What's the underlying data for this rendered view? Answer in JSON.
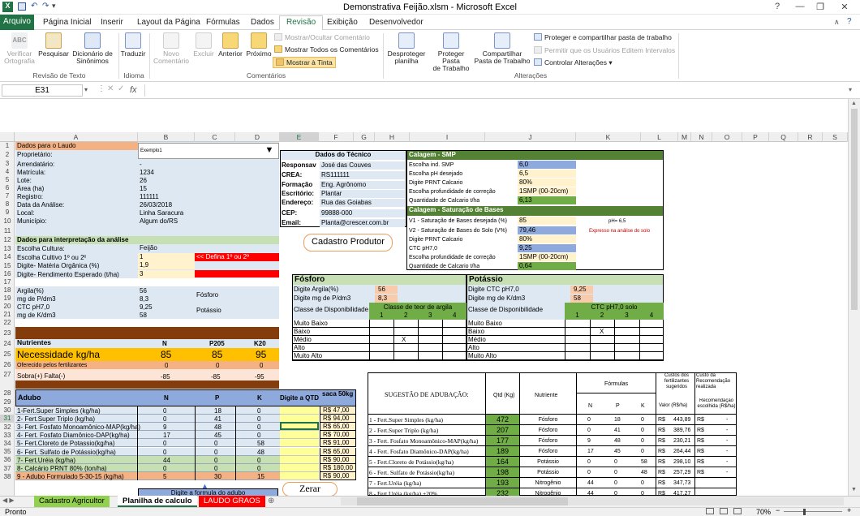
{
  "window": {
    "title": "Demonstrativa Feijão.xlsm  -  Microsoft Excel",
    "help": "?",
    "minimize": "—",
    "restore": "❐",
    "close": "✕"
  },
  "menu": {
    "file": "Arquivo",
    "tabs": [
      "Página Inicial",
      "Inserir",
      "Layout da Página",
      "Fórmulas",
      "Dados",
      "Revisão",
      "Exibição",
      "Desenvolvedor"
    ],
    "active": "Revisão"
  },
  "ribbon": {
    "groups": [
      "Revisão de Texto",
      "Idioma",
      "Comentários",
      "Alterações"
    ],
    "buttons": {
      "spell": "Verificar\nOrtografia",
      "search": "Pesquisar",
      "thesaurus": "Dicionário de\nSinônimos",
      "translate": "Traduzir",
      "newcomment": "Novo\nComentário",
      "delete": "Excluir",
      "prev": "Anterior",
      "next": "Próximo",
      "unprotect": "Desproteger\nplanilha",
      "protectwb": "Proteger Pasta\nde Trabalho",
      "sharewb": "Compartilhar\nPasta de Trabalho"
    },
    "comments_small": [
      "Mostrar/Ocultar Comentário",
      "Mostrar Todos os Comentários",
      "Mostrar à Tinta"
    ],
    "changes_small": [
      "Proteger e compartilhar pasta de trabalho",
      "Permitir que os Usuários Editem Intervalos",
      "Controlar Alterações ▾"
    ]
  },
  "formula_bar": {
    "namebox": "E31",
    "fx": "fx",
    "value": ""
  },
  "columns": [
    "A",
    "B",
    "C",
    "D",
    "E",
    "F",
    "G",
    "H",
    "I",
    "J",
    "K",
    "L",
    "M",
    "N",
    "O",
    "P",
    "Q",
    "R",
    "S"
  ],
  "rows": [
    "1",
    "2",
    "3",
    "4",
    "5",
    "6",
    "7",
    "8",
    "9",
    "10",
    "11",
    "12",
    "13",
    "14",
    "15",
    "16",
    "17",
    "18",
    "19",
    "20",
    "21",
    "22",
    "23",
    "24",
    "25",
    "26",
    "27",
    "28",
    "29",
    "30",
    "31",
    "32",
    "33",
    "34",
    "35",
    "36",
    "37",
    "38"
  ],
  "laudo": {
    "header": "Dados para o Laudo",
    "labels": [
      "Proprietário:",
      "Arrendatário:",
      "Matrícula:",
      "Lote:",
      "Área (ha)",
      "Registro:",
      "Data da Análise:",
      "Local:",
      "Município:"
    ],
    "values": [
      "Exemplo1",
      "-",
      "1234",
      "26",
      "15",
      "111111",
      "26/03/2018",
      "Linha Saracura",
      "Algum do/RS"
    ],
    "interp_header": "Dados para interpretação da análise",
    "interp_labels": [
      "Escolha Cultura:",
      "Escolha Cultivo 1º ou 2º",
      "Digite- Matéria Orgânica (%)",
      "Digite- Rendimento Esperado (t/ha)"
    ],
    "interp_values": [
      "Feijão",
      "1",
      "1,9",
      "3"
    ],
    "warning": "<< Defina 1º ou 2º",
    "soil_labels": [
      "Argila(%)",
      "mg de P/dm3",
      "CTC pH7,0",
      "mg de K/dm3"
    ],
    "soil_values": [
      "56",
      "8,3",
      "9,25",
      "58"
    ],
    "soil_tags": [
      "Fósforo",
      "Potássio"
    ]
  },
  "nutrientes": {
    "header": [
      "Nutrientes",
      "N",
      "P205",
      "K20"
    ],
    "necessidade": [
      "Necessidade kg/ha",
      "85",
      "85",
      "95"
    ],
    "oferecido": [
      "Oferecido pelos fertilizantes",
      "0",
      "0",
      "0"
    ],
    "sobra": [
      "Sobra(+) Falta(-)",
      "-85",
      "-85",
      "-95"
    ]
  },
  "adubo": {
    "header": [
      "Adubo",
      "N",
      "P",
      "K",
      "Digite a QTD",
      "saca 50kg"
    ],
    "rows": [
      [
        "1-Fert.Super Simples (kg/ha)",
        "0",
        "18",
        "0",
        "R$ 47,00"
      ],
      [
        "2- Fert.Super Triplo (kg/ha)",
        "0",
        "41",
        "0",
        "R$ 94,00"
      ],
      [
        "3- Fert. Fosfato Monoamônico-MAP(kg/ha)",
        "9",
        "48",
        "0",
        "R$ 65,00"
      ],
      [
        "4- Fert. Fosfato Diamônico-DAP(kg/ha)",
        "17",
        "45",
        "0",
        "R$ 70,00"
      ],
      [
        "5- Fert.Cloreto de Potassio(kg/ha)",
        "0",
        "0",
        "58",
        "R$ 91,00"
      ],
      [
        "6- Fert. Sulfato de Potássio(kg/ha)",
        "0",
        "0",
        "48",
        "R$ 65,00"
      ],
      [
        "7- Fert.Uréia (kg/ha)",
        "44",
        "0",
        "0",
        "R$ 90,00"
      ],
      [
        "8- Calcário PRNT 80% (ton/ha)",
        "0",
        "0",
        "0",
        "R$ 180,00"
      ],
      [
        "9 - Adubo Formulado 5-30-15 (kg/ha)",
        "5",
        "30",
        "15",
        "R$ 90,00"
      ]
    ],
    "hint": "Digite a formula do adubo",
    "zerar": "Zerar"
  },
  "tecnico": {
    "title": "Dados do Técnico",
    "labels": [
      "Responsav",
      "CREA:",
      "Formação",
      "Escritório:",
      "Endereço:",
      "CEP:",
      "Email:"
    ],
    "values": [
      "José das Couves",
      "RS111111",
      "Eng. Agrônomo",
      "Plantar",
      "Rua das Goiabas",
      "99888-000",
      "Planta@crescer.com.br"
    ],
    "button": "Cadastro Produtor"
  },
  "smp": {
    "title": "Calagem - SMP",
    "labels": [
      "Escolha ind. SMP",
      "Escolha pH desejado",
      "Digite PRNT Calcario",
      "Escolha profundidade de correção",
      "Quantidade de Calcario t/ha"
    ],
    "values": [
      "6,0",
      "6,5",
      "80%",
      "1SMP  (00-20cm)",
      "6,13"
    ]
  },
  "saturacao": {
    "title": "Calagem - Saturação de Bases",
    "labels": [
      "V1 - Saturação de Bases desejada (%)",
      "V2 - Saturação de Bases do Solo (V%)",
      "Digite PRNT Calcario",
      "CTC pH7,0",
      "Escolha profundidade de correção",
      "Quantidade de Calcario t/ha"
    ],
    "values": [
      "85",
      "79,46",
      "80%",
      "9,25",
      "1SMP  (00-20cm)",
      "0,64"
    ],
    "note1": "pH= 6,5",
    "note2": "Expresso na análise do solo"
  },
  "fosforo": {
    "title": "Fósforo",
    "labels": [
      "Digite Argila(%)",
      "Digite mg de P/dm3",
      "Classe de Disponibilidade"
    ],
    "values": [
      "56",
      "8,3"
    ],
    "teor": "Classe de teor de argila",
    "cols": [
      "1",
      "2",
      "3",
      "4"
    ],
    "classes": [
      "Muito Baixo",
      "Baixo",
      "Médio",
      "Alto",
      "Muito Alto"
    ],
    "mark": "X"
  },
  "potassio": {
    "title": "Potássio",
    "labels": [
      "Digite CTC pH7,0",
      "Digite mg de K/dm3",
      "Classe de Disponibilidade"
    ],
    "values": [
      "9,25",
      "58"
    ],
    "teor": "CTC pH7,0 solo",
    "cols": [
      "1",
      "2",
      "3",
      "4"
    ],
    "classes": [
      "Muito Baixo",
      "Baixo",
      "Médio",
      "Alto",
      "Muito Alto"
    ],
    "mark": "X"
  },
  "sugestoes": {
    "title": "SUGESTÃO DE ADUBAÇÃO:",
    "qtd": "Qtd (Kg)",
    "nutriente": "Nutriente",
    "formulas": "Fórmulas",
    "npk": [
      "N",
      "P",
      "K"
    ],
    "custos": "Custos dos fertilizantes sugeridos",
    "valor": "Valor (R$/ha)",
    "custo_rec": "Custo da Recomendação realizada",
    "rec_escolhida": "Recomendação escolhida (R$/ha)",
    "rows": [
      [
        "1 - Fert.Super Simples (kg/ha)",
        "472",
        "Fósforo",
        "0",
        "18",
        "0",
        "R$",
        "443,89",
        "R$",
        "-"
      ],
      [
        "2 - Fert.Super Triplo (kg/ha)",
        "207",
        "Fósforo",
        "0",
        "41",
        "0",
        "R$",
        "389,76",
        "R$",
        "-"
      ],
      [
        "3 - Fert. Fosfato Monoamônico-MAP(kg/ha)",
        "177",
        "Fósforo",
        "9",
        "48",
        "0",
        "R$",
        "230,21",
        "R$",
        "-"
      ],
      [
        "4 - Fert. Fosfato Diamônico-DAP(kg/ha)",
        "189",
        "Fósforo",
        "17",
        "45",
        "0",
        "R$",
        "264,44",
        "R$",
        "-"
      ],
      [
        "5 - Fert.Cloreto de Potássio(kg/ha)",
        "164",
        "Potássio",
        "0",
        "0",
        "58",
        "R$",
        "298,10",
        "R$",
        "-"
      ],
      [
        "6 - Fert. Sulfato de Potássio(kg/ha)",
        "198",
        "Potássio",
        "0",
        "0",
        "48",
        "R$",
        "257,29",
        "R$",
        "-"
      ],
      [
        "7 - Fert.Uréia (kg/ha)",
        "193",
        "Nitrogênio",
        "44",
        "0",
        "0",
        "R$",
        "347,73",
        "",
        ""
      ],
      [
        "8 - Fert.Uréia (kg/ha) +20%",
        "232",
        "Nitrogênio",
        "44",
        "0",
        "0",
        "R$",
        "417,27",
        "",
        ""
      ]
    ]
  },
  "sheets": {
    "tabs": [
      "Cadastro Agricultor",
      "Planilha de calculo",
      "LAUDO GRAOS"
    ],
    "active": "Planilha de calculo"
  },
  "status": {
    "ready": "Pronto",
    "zoom": "70%"
  }
}
